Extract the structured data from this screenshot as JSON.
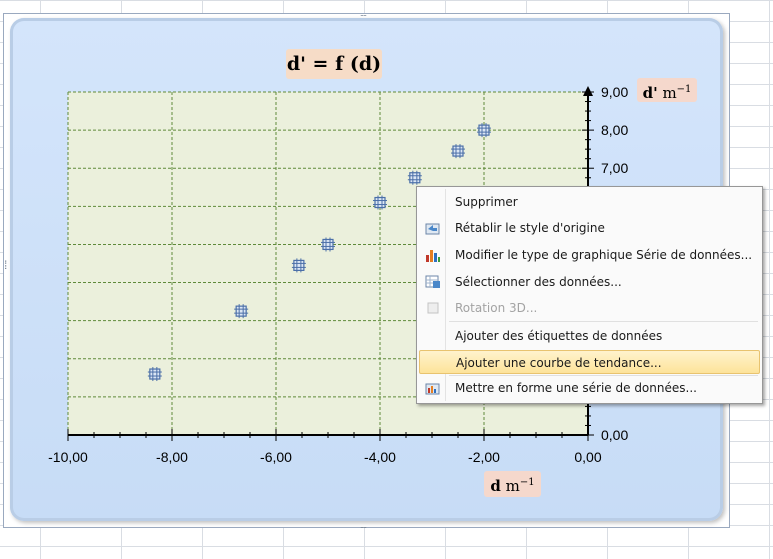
{
  "chart_data": {
    "type": "scatter",
    "title": "d' = f (d)",
    "xlabel": "d m⁻¹",
    "ylabel": "d' m⁻¹",
    "xlim": [
      -10,
      0
    ],
    "ylim": [
      0,
      9
    ],
    "x_ticks": [
      "-10,00",
      "-8,00",
      "-6,00",
      "-4,00",
      "-2,00",
      "0,00"
    ],
    "y_ticks": [
      "0,00",
      "7,00",
      "8,00",
      "9,00"
    ],
    "y_tick_values": [
      0,
      7,
      8,
      9
    ],
    "grid": true,
    "series": [
      {
        "x": [
          -8.33,
          -6.67,
          -5.56,
          -5.0,
          -4.0,
          -3.33,
          -2.5,
          -2.0
        ],
        "y": [
          1.6,
          3.25,
          4.45,
          5.0,
          6.1,
          6.75,
          7.45,
          8.0
        ]
      }
    ],
    "colors": {
      "plot_bg": "#ebf0dc",
      "grid": "#5f8a3a",
      "marker": "#4b6fa8"
    }
  },
  "title_parts": {
    "main": "d' = f (d)"
  },
  "axis_units": {
    "y_name": "d'",
    "y_unit": " m",
    "y_exp": "−1",
    "x_name": "d",
    "x_unit": " m",
    "x_exp": "−1"
  },
  "handles": {
    "top": "....",
    "bottom": "....",
    "left": "⁞"
  },
  "context_menu": {
    "items": [
      {
        "label": "Supprimer",
        "icon": "none",
        "disabled": false
      },
      {
        "label": "Rétablir le style d'origine",
        "icon": "reset-style-icon",
        "disabled": false
      },
      {
        "label": "Modifier le type de graphique Série de données...",
        "icon": "chart-type-icon",
        "disabled": false
      },
      {
        "label": "Sélectionner des données...",
        "icon": "select-data-icon",
        "disabled": false
      },
      {
        "label": "Rotation 3D...",
        "icon": "rotation-3d-icon",
        "disabled": true
      },
      {
        "label": "Ajouter des étiquettes de données",
        "icon": "none",
        "disabled": false
      },
      {
        "label": "Ajouter une courbe de tendance...",
        "icon": "none",
        "disabled": false,
        "highlighted": true
      },
      {
        "label": "Mettre en forme une série de données...",
        "icon": "format-series-icon",
        "disabled": false
      }
    ]
  }
}
